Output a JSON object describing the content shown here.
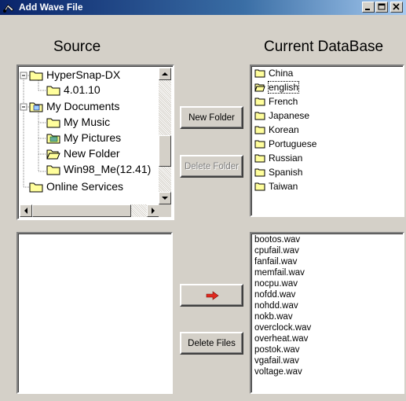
{
  "window": {
    "title": "Add Wave File",
    "controls": {
      "minimize": "minimize",
      "maximize": "maximize",
      "close": "close"
    }
  },
  "source": {
    "heading": "Source",
    "tree": [
      {
        "label": "HyperSnap-DX",
        "icon": "folder-icon",
        "expanded": true
      },
      {
        "label": "4.01.10",
        "icon": "folder-icon"
      },
      {
        "label": "My Documents",
        "icon": "my-documents-icon",
        "expanded": true
      },
      {
        "label": "My Music",
        "icon": "folder-icon"
      },
      {
        "label": "My Pictures",
        "icon": "pictures-folder-icon"
      },
      {
        "label": "New Folder",
        "icon": "open-folder-icon"
      },
      {
        "label": "Win98_Me(12.41)",
        "icon": "folder-icon"
      },
      {
        "label": "Online Services",
        "icon": "folder-icon"
      }
    ],
    "files": []
  },
  "database": {
    "heading": "Current DataBase",
    "folders": [
      {
        "label": "China",
        "icon": "folder-icon",
        "selected": false
      },
      {
        "label": "english",
        "icon": "open-folder-icon",
        "selected": true
      },
      {
        "label": "French",
        "icon": "folder-icon",
        "selected": false
      },
      {
        "label": "Japanese",
        "icon": "folder-icon",
        "selected": false
      },
      {
        "label": "Korean",
        "icon": "folder-icon",
        "selected": false
      },
      {
        "label": "Portuguese",
        "icon": "folder-icon",
        "selected": false
      },
      {
        "label": "Russian",
        "icon": "folder-icon",
        "selected": false
      },
      {
        "label": "Spanish",
        "icon": "folder-icon",
        "selected": false
      },
      {
        "label": "Taiwan",
        "icon": "folder-icon",
        "selected": false
      }
    ],
    "files": [
      "bootos.wav",
      "cpufail.wav",
      "fanfail.wav",
      "memfail.wav",
      "nocpu.wav",
      "nofdd.wav",
      "nohdd.wav",
      "nokb.wav",
      "overclock.wav",
      "overheat.wav",
      "postok.wav",
      "vgafail.wav",
      "voltage.wav"
    ]
  },
  "buttons": {
    "new_folder": "New Folder",
    "delete_folder": "Delete Folder",
    "add_arrow_icon": "right-arrow-icon",
    "delete_files": "Delete Files"
  },
  "colors": {
    "face": "#d4d0c8",
    "title_start": "#0a246a",
    "title_end": "#a6caf0",
    "folder": "#fffe9c",
    "arrow": "#e0281e"
  }
}
